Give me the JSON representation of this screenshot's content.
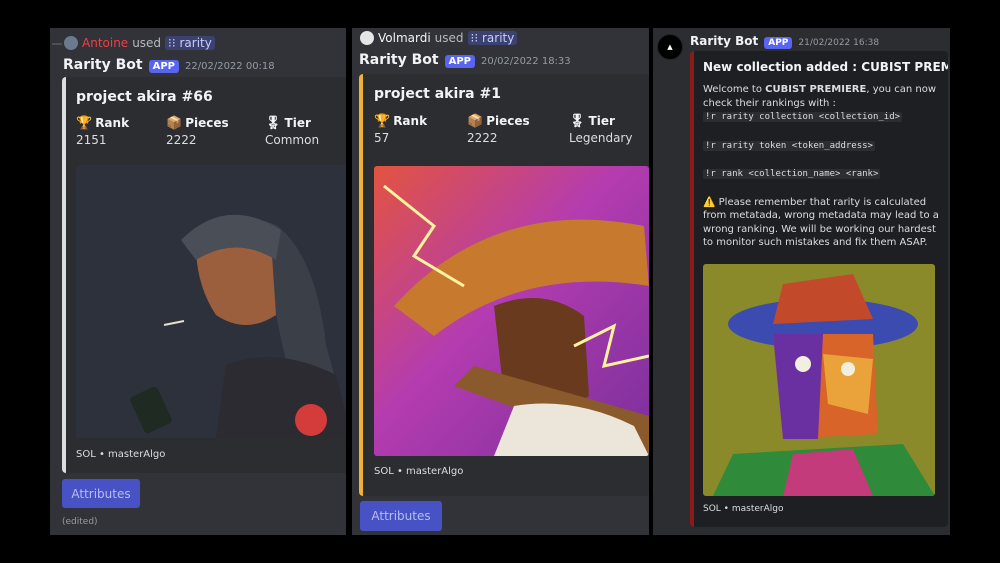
{
  "panel1": {
    "reply": {
      "user": "Antoine",
      "used": "used",
      "command": "rarity"
    },
    "bot": {
      "name": "Rarity Bot",
      "badge": "APP",
      "timestamp": "22/02/2022 00:18"
    },
    "embed": {
      "title": "project akira #66",
      "fields": [
        {
          "icon": "trophy-icon",
          "glyph": "🏆",
          "name": "Rank",
          "value": "2151"
        },
        {
          "icon": "package-icon",
          "glyph": "📦",
          "name": "Pieces",
          "value": "2222"
        },
        {
          "icon": "medal-icon",
          "glyph": "🎖",
          "name": "Tier",
          "value": "Common"
        }
      ],
      "footer": "SOL • masterAlgo",
      "accent": "#dbdee1"
    },
    "button": "Attributes",
    "edited": "(edited)"
  },
  "panel2": {
    "reply": {
      "user": "Volmardi",
      "used": "used",
      "command": "rarity"
    },
    "bot": {
      "name": "Rarity Bot",
      "badge": "APP",
      "timestamp": "20/02/2022 18:33"
    },
    "embed": {
      "title": "project akira #1",
      "fields": [
        {
          "icon": "trophy-icon",
          "glyph": "🏆",
          "name": "Rank",
          "value": "57"
        },
        {
          "icon": "package-icon",
          "glyph": "📦",
          "name": "Pieces",
          "value": "2222"
        },
        {
          "icon": "medal-icon",
          "glyph": "🎖",
          "name": "Tier",
          "value": "Legendary"
        }
      ],
      "footer": "SOL • masterAlgo",
      "accent": "#f0b232"
    },
    "button": "Attributes"
  },
  "panel3": {
    "bot": {
      "name": "Rarity Bot",
      "badge": "APP",
      "timestamp": "21/02/2022 16:38"
    },
    "embed": {
      "title": "New collection added : CUBIST PREMIERE",
      "intro_pre": "Welcome to ",
      "intro_bold": "CUBIST PREMIERE",
      "intro_post": ", you can now check their rankings with :",
      "cmd1": "!r rarity collection <collection_id>",
      "cmd2": "!r rarity token <token_address>",
      "cmd3": "!r rank <collection_name> <rank>",
      "warning_glyph": "⚠️",
      "warning": "Please remember that rarity is calculated from metatada, wrong metadata may lead to a wrong ranking. We will be working our hardest to monitor such mistakes and fix them ASAP.",
      "footer": "SOL • masterAlgo",
      "accent": "#8b1a1a"
    }
  }
}
